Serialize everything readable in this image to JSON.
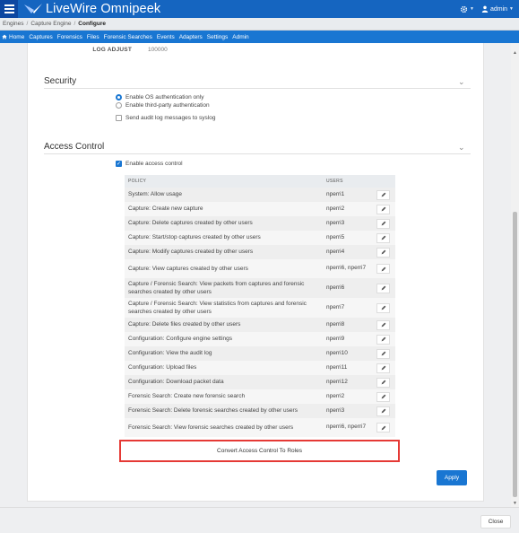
{
  "app": {
    "title": "LiveWire Omnipeek",
    "menu_icon": "hamburger-icon",
    "logo_icon": "livewire-logo",
    "brand_color": "#1565c0"
  },
  "header_right": {
    "settings_icon": "gear-icon",
    "user_icon": "user-icon",
    "user_label": "admin"
  },
  "breadcrumb": [
    "Engines",
    "Capture Engine",
    "Configure"
  ],
  "nav": {
    "home_icon": "home-icon",
    "items": [
      "Home",
      "Captures",
      "Forensics",
      "Files",
      "Forensic Searches",
      "Events",
      "Adapters",
      "Settings",
      "Admin"
    ]
  },
  "log_adjust": {
    "label": "LOG ADJUST",
    "value": "100000"
  },
  "security": {
    "title": "Security",
    "options": [
      {
        "label": "Enable OS authentication only",
        "selected": true
      },
      {
        "label": "Enable third-party authentication",
        "selected": false
      }
    ],
    "syslog": {
      "label": "Send audit log messages to syslog",
      "checked": false
    }
  },
  "access_control": {
    "title": "Access Control",
    "enable": {
      "label": "Enable access control",
      "checked": true
    },
    "columns": {
      "policy": "POLICY",
      "users": "USERS"
    },
    "rows": [
      {
        "policy": "System: Allow usage",
        "users": "nperri1"
      },
      {
        "policy": "Capture: Create new capture",
        "users": "nperri2"
      },
      {
        "policy": "Capture: Delete captures created by other users",
        "users": "nperri3"
      },
      {
        "policy": "Capture: Start/stop captures created by other users",
        "users": "nperri5"
      },
      {
        "policy": "Capture: Modify captures created by other users",
        "users": "nperri4"
      },
      {
        "policy": "Capture: View captures created by other users",
        "users": "nperri6, nperri7"
      },
      {
        "policy": "Capture / Forensic Search: View packets from captures and forensic searches created by other users",
        "users": "nperri6"
      },
      {
        "policy": "Capture / Forensic Search: View statistics from captures and forensic searches created by other users",
        "users": "nperri7"
      },
      {
        "policy": "Capture: Delete files created by other users",
        "users": "nperri8"
      },
      {
        "policy": "Configuration: Configure engine settings",
        "users": "nperri9"
      },
      {
        "policy": "Configuration: View the audit log",
        "users": "nperri10"
      },
      {
        "policy": "Configuration: Upload files",
        "users": "nperri11"
      },
      {
        "policy": "Configuration: Download packet data",
        "users": "nperri12"
      },
      {
        "policy": "Forensic Search: Create new forensic search",
        "users": "nperri2"
      },
      {
        "policy": "Forensic Search: Delete forensic searches created by other users",
        "users": "nperri3"
      },
      {
        "policy": "Forensic Search: View forensic searches created by other users",
        "users": "nperri6, nperri7"
      }
    ],
    "convert_label": "Convert Access Control To Roles"
  },
  "buttons": {
    "apply": "Apply",
    "close": "Close"
  }
}
